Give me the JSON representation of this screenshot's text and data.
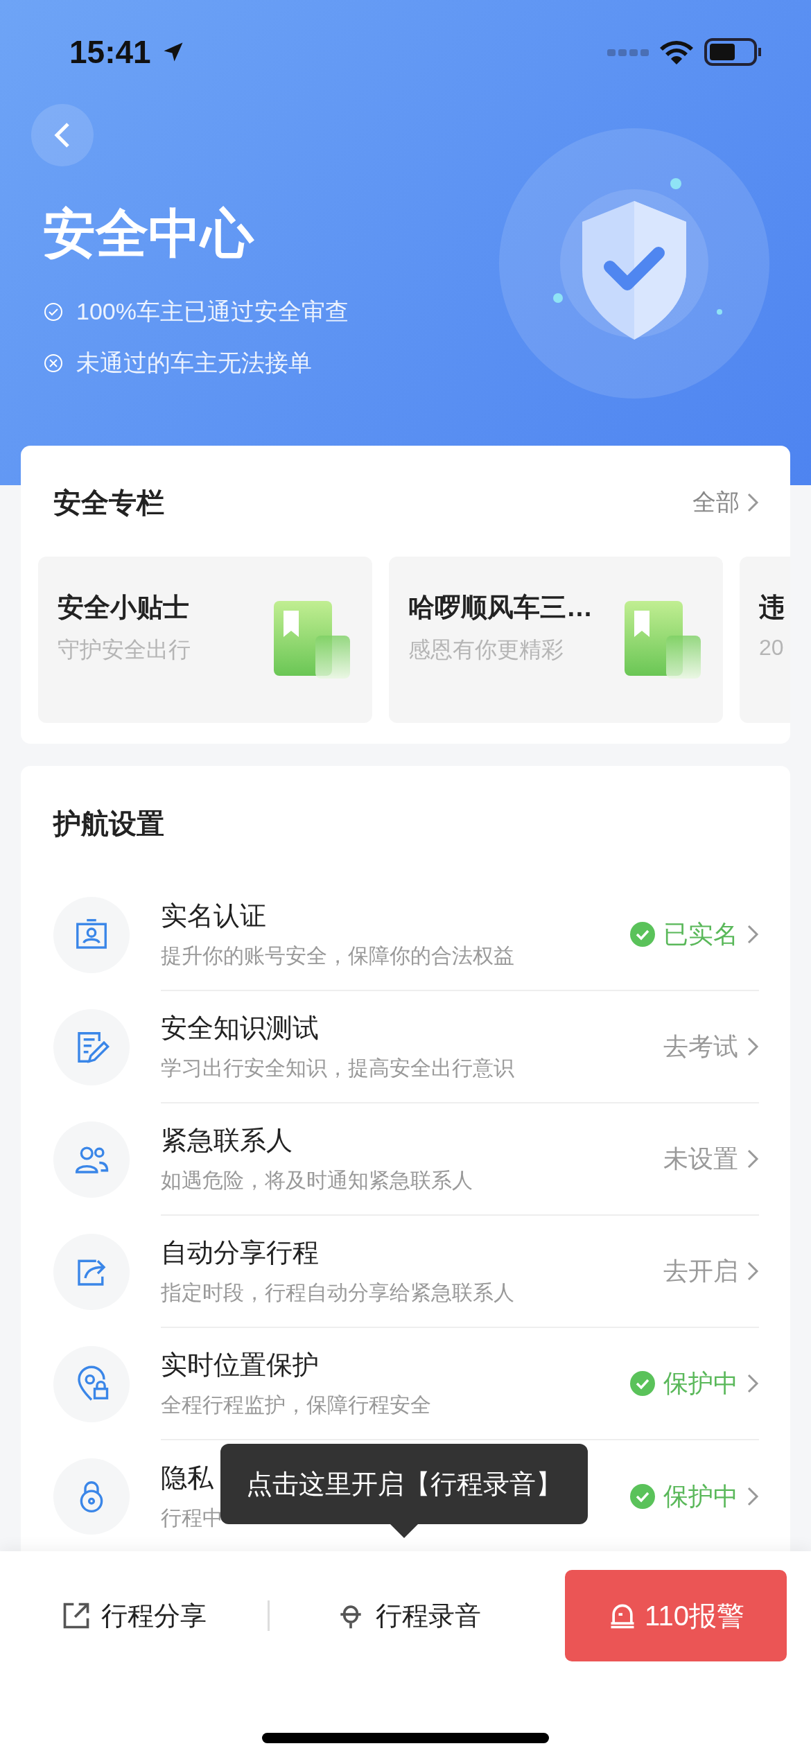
{
  "status_bar": {
    "time": "15:41"
  },
  "header": {
    "title": "安全中心",
    "points": [
      {
        "kind": "check",
        "text": "100%车主已通过安全审查"
      },
      {
        "kind": "cross",
        "text": "未通过的车主无法接单"
      }
    ]
  },
  "column": {
    "title": "安全专栏",
    "more": "全部",
    "tiles": [
      {
        "kind": "book",
        "title": "安全小贴士",
        "subtitle": "守护安全出行"
      },
      {
        "kind": "book",
        "title": "哈啰顺风车三…",
        "subtitle": "感恩有你更精彩"
      },
      {
        "title": "违",
        "subtitle": "20"
      }
    ]
  },
  "settings": {
    "title": "护航设置",
    "items": [
      {
        "kind": "id-card",
        "title": "实名认证",
        "subtitle": "提升你的账号安全，保障你的合法权益",
        "status": "已实名",
        "active": true
      },
      {
        "kind": "edit",
        "title": "安全知识测试",
        "subtitle": "学习出行安全知识，提高安全出行意识",
        "status": "去考试",
        "active": false
      },
      {
        "kind": "contacts",
        "title": "紧急联系人",
        "subtitle": "如遇危险，将及时通知紧急联系人",
        "status": "未设置",
        "active": false
      },
      {
        "kind": "share",
        "title": "自动分享行程",
        "subtitle": "指定时段，行程自动分享给紧急联系人",
        "status": "去开启",
        "active": false
      },
      {
        "kind": "location",
        "title": "实时位置保护",
        "subtitle": "全程行程监护，保障行程安全",
        "status": "保护中",
        "active": true
      },
      {
        "kind": "lock",
        "title": "隐私",
        "subtitle": "行程中",
        "status": "保护中",
        "active": true
      }
    ]
  },
  "tooltip": {
    "text": "点击这里开启【行程录音】"
  },
  "bottom_bar": {
    "actions": [
      {
        "kind": "share",
        "label": "行程分享"
      },
      {
        "kind": "record",
        "label": "行程录音"
      }
    ],
    "alarm": {
      "label": "110报警"
    }
  }
}
